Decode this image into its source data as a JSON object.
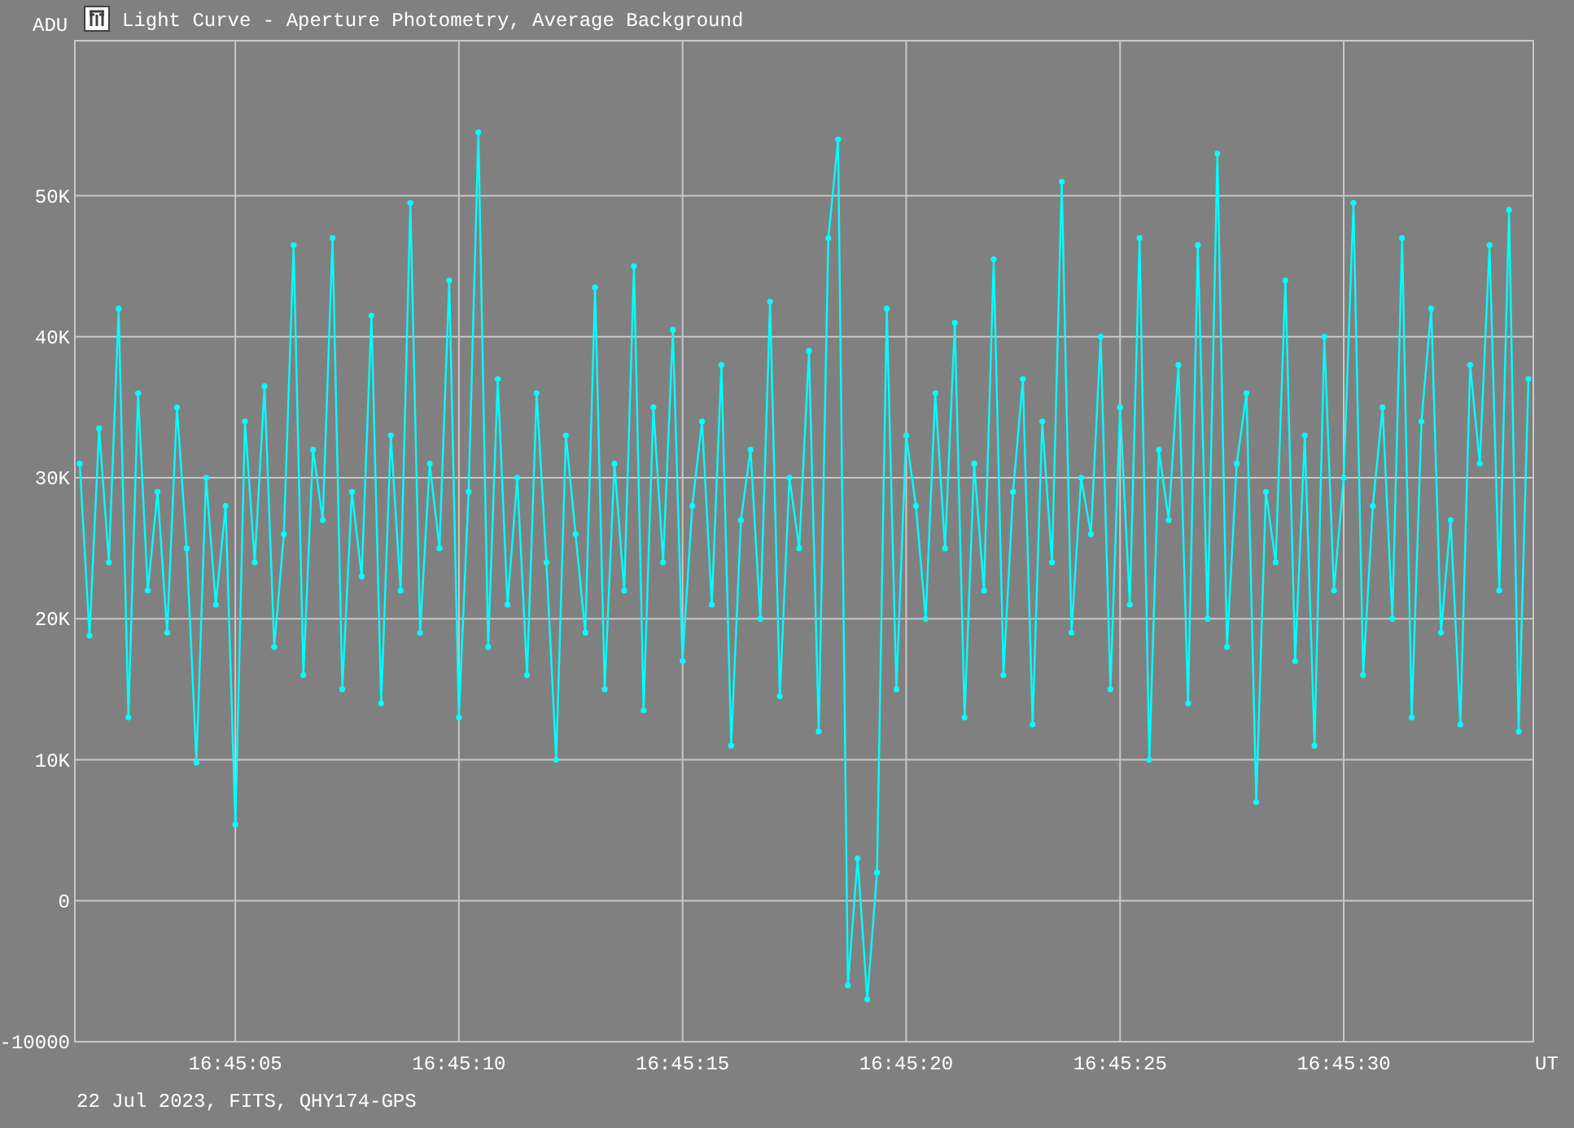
{
  "window": {
    "title": "Light Curve - Aperture Photometry, Average Background"
  },
  "chart": {
    "footer": "22 Jul 2023, FITS, QHY174-GPS",
    "chart_data": {
      "type": "line",
      "ylabel": "ADU",
      "xlabel": "UT",
      "grid": true,
      "ylim": [
        -10000,
        61000
      ],
      "yticks": [
        {
          "value": 50000,
          "label": "50K"
        },
        {
          "value": 40000,
          "label": "40K"
        },
        {
          "value": 30000,
          "label": "30K"
        },
        {
          "value": 20000,
          "label": "20K"
        },
        {
          "value": 10000,
          "label": "10K"
        },
        {
          "value": 0,
          "label": "0"
        },
        {
          "value": -10000,
          "label": "-10000"
        }
      ],
      "categories": [
        null,
        null,
        null,
        null,
        null,
        null,
        null,
        null,
        null,
        null,
        null,
        null,
        null,
        null,
        null,
        null,
        "16:45:05",
        null,
        null,
        null,
        null,
        null,
        null,
        null,
        null,
        null,
        null,
        null,
        null,
        null,
        null,
        null,
        null,
        null,
        null,
        null,
        null,
        null,
        null,
        "16:45:10",
        null,
        null,
        null,
        null,
        null,
        null,
        null,
        null,
        null,
        null,
        null,
        null,
        null,
        null,
        null,
        null,
        null,
        null,
        null,
        null,
        null,
        null,
        "16:45:15",
        null,
        null,
        null,
        null,
        null,
        null,
        null,
        null,
        null,
        null,
        null,
        null,
        null,
        null,
        null,
        null,
        null,
        null,
        null,
        null,
        null,
        null,
        "16:45:20",
        null,
        null,
        null,
        null,
        null,
        null,
        null,
        null,
        null,
        null,
        null,
        null,
        null,
        null,
        null,
        null,
        null,
        null,
        null,
        null,
        null,
        "16:45:25",
        null,
        null,
        null,
        null,
        null,
        null,
        null,
        null,
        null,
        null,
        null,
        null,
        null,
        null,
        null,
        null,
        null,
        null,
        null,
        null,
        null,
        null,
        "16:45:30",
        null,
        null,
        null,
        null,
        null,
        null,
        null,
        null,
        null,
        null,
        null,
        null,
        null,
        null,
        null,
        null,
        null,
        null,
        null
      ],
      "series": [
        {
          "color": "#00ffff",
          "marker": "circle",
          "values": [
            31000,
            18800,
            33500,
            24000,
            42000,
            13000,
            36000,
            22000,
            29000,
            19000,
            35000,
            25000,
            9800,
            30000,
            21000,
            28000,
            5400,
            34000,
            24000,
            36500,
            18000,
            26000,
            46500,
            16000,
            32000,
            27000,
            47000,
            15000,
            29000,
            23000,
            41500,
            14000,
            33000,
            22000,
            49500,
            19000,
            31000,
            25000,
            44000,
            13000,
            29000,
            54500,
            18000,
            37000,
            21000,
            30000,
            16000,
            36000,
            24000,
            10000,
            33000,
            26000,
            19000,
            43500,
            15000,
            31000,
            22000,
            45000,
            13500,
            35000,
            24000,
            40500,
            17000,
            28000,
            34000,
            21000,
            38000,
            11000,
            27000,
            32000,
            20000,
            42500,
            14500,
            30000,
            25000,
            39000,
            12000,
            47000,
            54000,
            -6000,
            3000,
            -7000,
            2000,
            42000,
            15000,
            33000,
            28000,
            20000,
            36000,
            25000,
            41000,
            13000,
            31000,
            22000,
            45500,
            16000,
            29000,
            37000,
            12500,
            34000,
            24000,
            51000,
            19000,
            30000,
            26000,
            40000,
            15000,
            35000,
            21000,
            47000,
            10000,
            32000,
            27000,
            38000,
            14000,
            46500,
            20000,
            53000,
            18000,
            31000,
            36000,
            7000,
            29000,
            24000,
            44000,
            17000,
            33000,
            11000,
            40000,
            22000,
            30000,
            49500,
            16000,
            28000,
            35000,
            20000,
            47000,
            13000,
            34000,
            42000,
            19000,
            27000,
            12500,
            38000,
            31000,
            46500,
            22000,
            49000,
            12000,
            37000
          ]
        }
      ]
    }
  }
}
